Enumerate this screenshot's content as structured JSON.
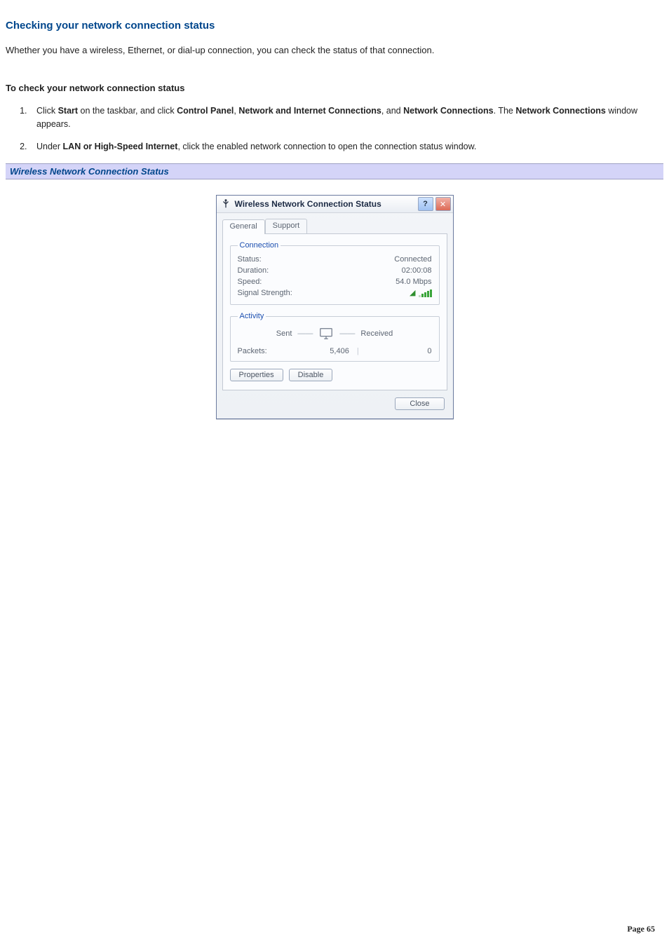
{
  "heading": "Checking your network connection status",
  "intro": "Whether you have a wireless, Ethernet, or dial-up connection, you can check the status of that connection.",
  "subhead": "To check your network connection status",
  "steps": {
    "s1": {
      "t1": "Click ",
      "b1": "Start",
      "t2": " on the taskbar, and click ",
      "b2": "Control Panel",
      "t3": ", ",
      "b3": "Network and Internet Connections",
      "t4": ", and ",
      "b4": "Network Connections",
      "t5": ". The ",
      "b5": "Network Connections",
      "t6": " window appears."
    },
    "s2": {
      "t1": "Under ",
      "b1": "LAN or High-Speed Internet",
      "t2": ", click the enabled network connection to open the connection status window."
    }
  },
  "caption": "Wireless Network Connection Status",
  "dialog": {
    "title": "Wireless Network Connection Status",
    "help": "?",
    "close": "✕",
    "tabs": {
      "general": "General",
      "support": "Support"
    },
    "group_connection": "Connection",
    "status_label": "Status:",
    "status_value": "Connected",
    "duration_label": "Duration:",
    "duration_value": "02:00:08",
    "speed_label": "Speed:",
    "speed_value": "54.0 Mbps",
    "signal_label": "Signal Strength:",
    "group_activity": "Activity",
    "sent": "Sent",
    "received": "Received",
    "packets_label": "Packets:",
    "packets_sent": "5,406",
    "packets_received": "0",
    "btn_properties": "Properties",
    "btn_disable": "Disable",
    "btn_close": "Close"
  },
  "page_label": "Page ",
  "page_number": "65"
}
